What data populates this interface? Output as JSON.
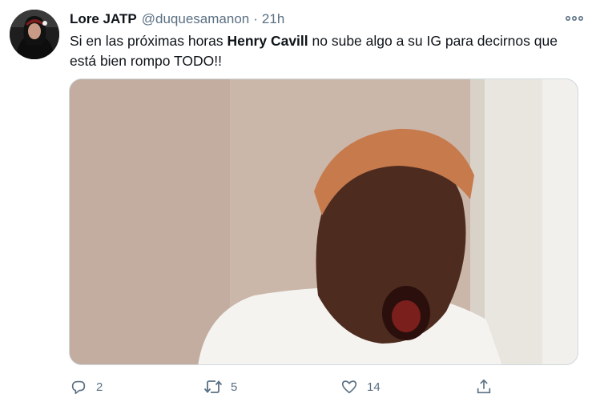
{
  "tweet": {
    "display_name": "Lore JATP",
    "handle": "@duquesamanon",
    "separator": "·",
    "time": "21h",
    "text_before": "Si en las próximas horas ",
    "text_bold": "Henry Cavill",
    "text_after": " no sube algo a su IG para decirnos que está bien rompo TODO!!"
  },
  "actions": {
    "reply_count": "2",
    "retweet_count": "5",
    "like_count": "14"
  },
  "icons": {
    "more": "more-icon",
    "reply": "reply-icon",
    "retweet": "retweet-icon",
    "like": "heart-icon",
    "share": "share-icon"
  },
  "colors": {
    "text": "#0f1419",
    "secondary": "#5b7083",
    "border": "#cfd9de"
  }
}
